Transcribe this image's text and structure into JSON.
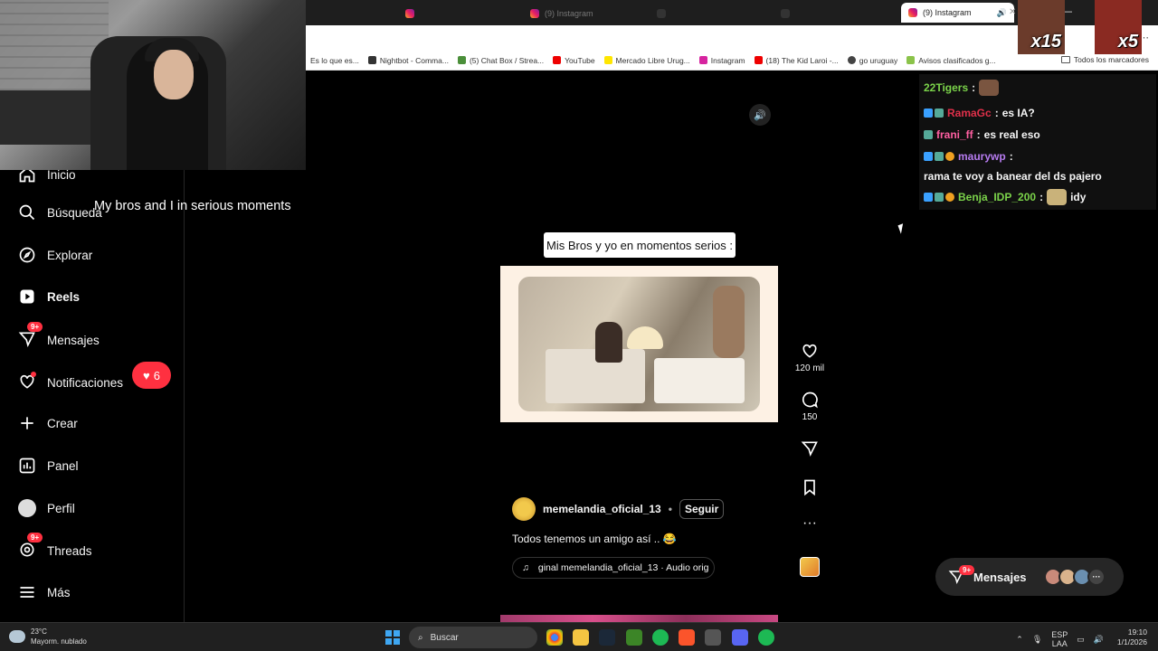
{
  "browser": {
    "tabs": [
      "",
      "(9) Instagram",
      "",
      "",
      "(9) Instagram"
    ],
    "active_tab": "(9) Instagram",
    "bookmarks": [
      "Es lo que es...",
      "Nightbot - Comma...",
      "(5) Chat Box / Strea...",
      "YouTube",
      "Mercado Libre Urug...",
      "Instagram",
      "(18) The Kid Laroi -...",
      "go uruguay",
      "Avisos clasificados g..."
    ],
    "bookmarks_folder": "Todos los marcadores"
  },
  "emotes": [
    "x15",
    "x5"
  ],
  "sidebar": {
    "items": [
      {
        "label": "Inicio",
        "icon": "home-icon"
      },
      {
        "label": "Búsqueda",
        "icon": "search-icon"
      },
      {
        "label": "Explorar",
        "icon": "compass-icon"
      },
      {
        "label": "Reels",
        "icon": "reels-icon"
      },
      {
        "label": "Mensajes",
        "icon": "messages-icon",
        "badge": "9+"
      },
      {
        "label": "Notificaciones",
        "icon": "heart-icon"
      },
      {
        "label": "Crear",
        "icon": "plus-icon"
      },
      {
        "label": "Panel",
        "icon": "chart-icon"
      },
      {
        "label": "Perfil",
        "icon": "profile-icon"
      },
      {
        "label": "Threads",
        "icon": "threads-icon",
        "badge": "9+"
      },
      {
        "label": "Más",
        "icon": "menu-icon"
      }
    ],
    "notifications_count": "6"
  },
  "subtitle_overlay": "My bros and I in serious moments",
  "reel": {
    "caption_text": "Mis Bros y yo en momentos serios :",
    "author": "memelandia_oficial_13",
    "separator": "•",
    "follow_label": "Seguir",
    "description": "Todos tenemos un amigo así .. 😂",
    "audio": "ginal        memelandia_oficial_13 · Audio orig",
    "likes": "120 mil",
    "comments": "150"
  },
  "chat": [
    {
      "user": "22Tigers",
      "color": "#7bd34a",
      "text": ""
    },
    {
      "user": "RamaGc",
      "color": "#e0304a",
      "text": "es IA?"
    },
    {
      "user": "frani_ff",
      "color": "#ff5fa2",
      "text": "es real eso"
    },
    {
      "user": "maurywp",
      "color": "#b77cf0",
      "text": "rama te voy a banear del ds pajero"
    },
    {
      "user": "Benja_IDP_200",
      "color": "#7bd34a",
      "text": "idy"
    }
  ],
  "messages_pill": {
    "label": "Mensajes",
    "badge": "9+"
  },
  "taskbar": {
    "temperature": "23°C",
    "weather": "Mayorm. nublado",
    "search_placeholder": "Buscar",
    "lang": "ESP",
    "lang2": "LAA",
    "time": "19:10",
    "date": "1/1/2026"
  },
  "colors": {
    "accent_red": "#ff3040",
    "bg": "#000000"
  }
}
